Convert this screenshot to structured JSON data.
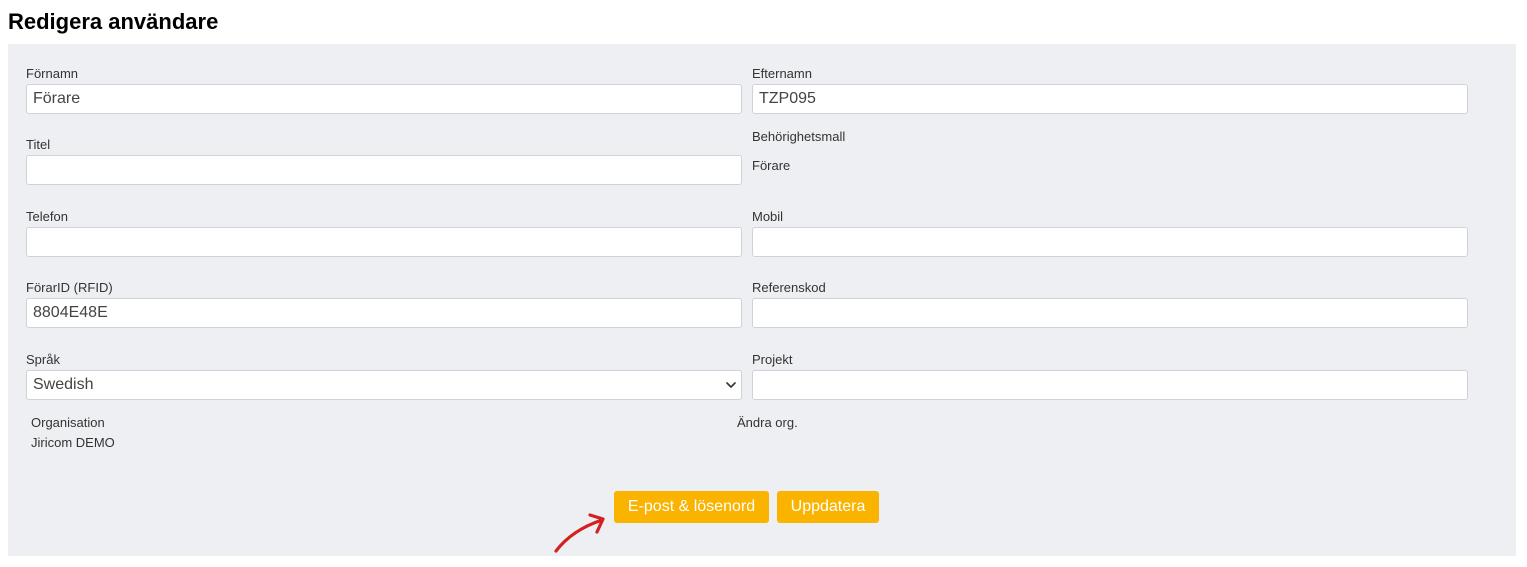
{
  "page_title": "Redigera användare",
  "form": {
    "first_name": {
      "label": "Förnamn",
      "value": "Förare"
    },
    "last_name": {
      "label": "Efternamn",
      "value": "TZP095"
    },
    "title": {
      "label": "Titel",
      "value": ""
    },
    "permission_template": {
      "label": "Behörighetsmall",
      "value": "Förare"
    },
    "phone": {
      "label": "Telefon",
      "value": ""
    },
    "mobile": {
      "label": "Mobil",
      "value": ""
    },
    "driver_id": {
      "label": "FörarID (RFID)",
      "value": "8804E48E"
    },
    "reference_code": {
      "label": "Referenskod",
      "value": ""
    },
    "language": {
      "label": "Språk",
      "value": "Swedish"
    },
    "project": {
      "label": "Projekt",
      "value": ""
    },
    "organisation": {
      "label": "Organisation",
      "value": "Jiricom DEMO"
    },
    "change_org_label": "Ändra org."
  },
  "buttons": {
    "email_password": "E-post & lösenord",
    "update": "Uppdatera"
  },
  "colors": {
    "button_bg": "#fab400",
    "panel_bg": "#eeeff3",
    "annotation_arrow": "#d42020"
  },
  "icons": {
    "language_select": "chevron-down-icon",
    "annotation": "curved-arrow-icon"
  }
}
